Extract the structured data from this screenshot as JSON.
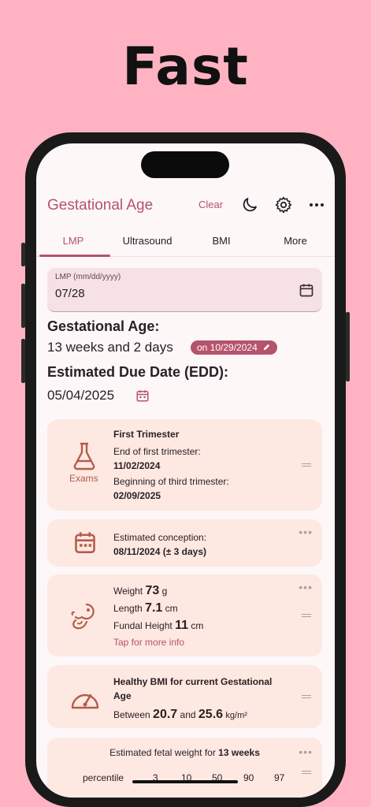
{
  "headline": "Fast",
  "appbar": {
    "title": "Gestational Age",
    "clear_label": "Clear"
  },
  "tabs": [
    {
      "label": "LMP",
      "active": true
    },
    {
      "label": "Ultrasound"
    },
    {
      "label": "BMI"
    },
    {
      "label": "More"
    }
  ],
  "lmp": {
    "label": "LMP (mm/dd/yyyy)",
    "value": "07/28"
  },
  "gestational_age": {
    "heading": "Gestational Age:",
    "value": "13 weeks and 2 days",
    "date_chip": "on 10/29/2024"
  },
  "edd": {
    "heading": "Estimated Due Date (EDD):",
    "value": "05/04/2025"
  },
  "trimester_card": {
    "icon_label": "Exams",
    "title": "First Trimester",
    "end_label": "End of first trimester:",
    "end_value": "11/02/2024",
    "begin_label": "Beginning of third trimester:",
    "begin_value": "02/09/2025"
  },
  "conception_card": {
    "label": "Estimated conception:",
    "value": "08/11/2024 (± 3 days)"
  },
  "size_card": {
    "weight_label": "Weight",
    "weight_value": "73",
    "weight_unit": "g",
    "length_label": "Length",
    "length_value": "7.1",
    "length_unit": "cm",
    "fundal_label": "Fundal Height",
    "fundal_value": "11",
    "fundal_unit": "cm",
    "link": "Tap for more info"
  },
  "bmi_card": {
    "title": "Healthy BMI for current Gestational Age",
    "between_label": "Between",
    "low": "20.7",
    "and_label": "and",
    "high": "25.6",
    "unit": "kg/m²"
  },
  "fetal_card": {
    "title_prefix": "Estimated fetal weight for",
    "title_weeks": "13 weeks",
    "percentile_label": "percentile",
    "percentiles": [
      "3",
      "10",
      "50",
      "90",
      "97"
    ]
  },
  "colors": {
    "accent": "#b5536b",
    "card": "#fde8e2",
    "background": "#ffb3c2"
  },
  "icons": [
    "moon-icon",
    "gear-icon",
    "more-horizontal-icon",
    "calendar-icon",
    "flask-icon",
    "fetus-icon",
    "scale-gauge-icon",
    "pencil-icon"
  ]
}
